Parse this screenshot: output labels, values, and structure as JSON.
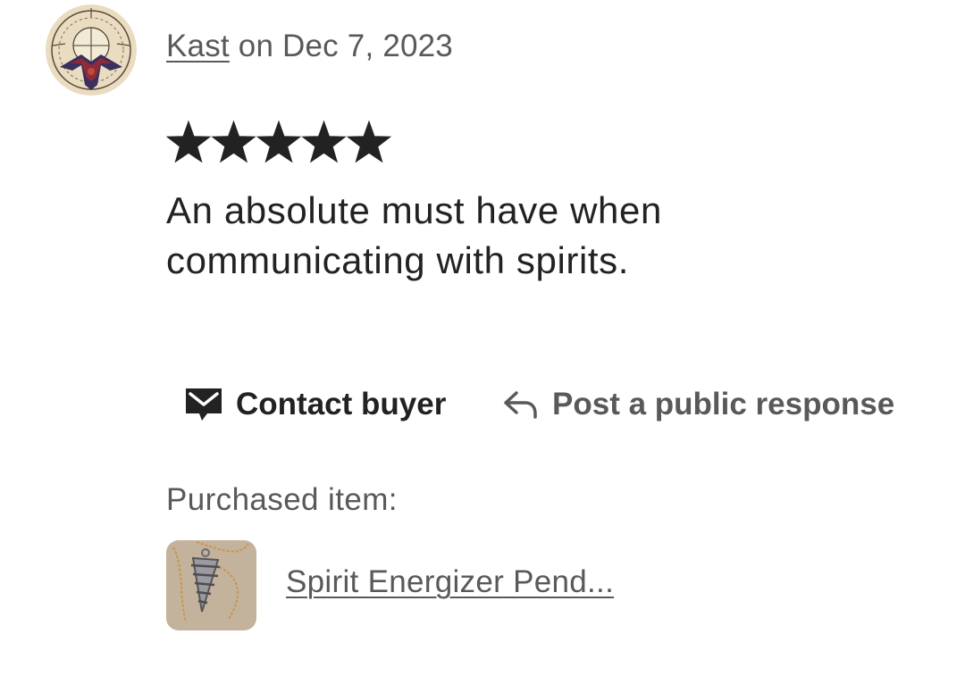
{
  "review": {
    "author": "Kast",
    "date_text": "on Dec 7, 2023",
    "rating": 5,
    "max_rating": 5,
    "text": "An absolute must have when communicating with spirits.",
    "avatar_icon": "tribal-compass-emblem-icon",
    "star_color": "#222222"
  },
  "actions": {
    "contact_label": "Contact buyer",
    "contact_icon": "message-envelope-icon",
    "respond_label": "Post a public response",
    "respond_icon": "reply-arrow-icon"
  },
  "purchase": {
    "label": "Purchased item:",
    "item_name": "Spirit Energizer Pend...",
    "thumbnail_icon": "pendant-photo-icon"
  }
}
